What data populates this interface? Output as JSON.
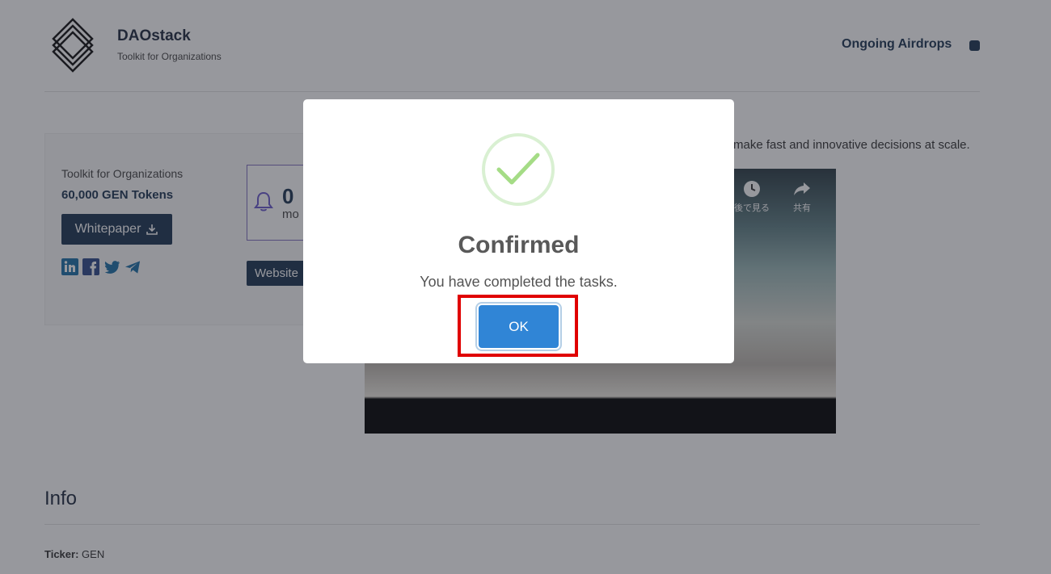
{
  "header": {
    "brand_name": "DAOstack",
    "brand_tagline": "Toolkit for Organizations",
    "nav_link": "Ongoing Airdrops"
  },
  "card": {
    "subtitle": "Toolkit for Organizations",
    "tokens": "60,000 GEN Tokens",
    "whitepaper_label": "Whitepaper",
    "countdown_number": "0",
    "countdown_unit": "mo",
    "website_label": "Website",
    "socials": [
      "linkedin-icon",
      "facebook-icon",
      "twitter-icon",
      "telegram-icon"
    ]
  },
  "description": "make fast and innovative decisions at scale.",
  "video": {
    "watch_later_label": "後で見る",
    "share_label": "共有"
  },
  "info": {
    "title": "Info",
    "ticker_label": "Ticker:",
    "ticker_value": "GEN"
  },
  "modal": {
    "title": "Confirmed",
    "text": "You have completed the tasks.",
    "ok_label": "OK"
  },
  "colors": {
    "brand_navy": "#1c3452",
    "ok_blue": "#3085d6",
    "check_green": "#a5dc86",
    "highlight_red": "#e00000"
  }
}
